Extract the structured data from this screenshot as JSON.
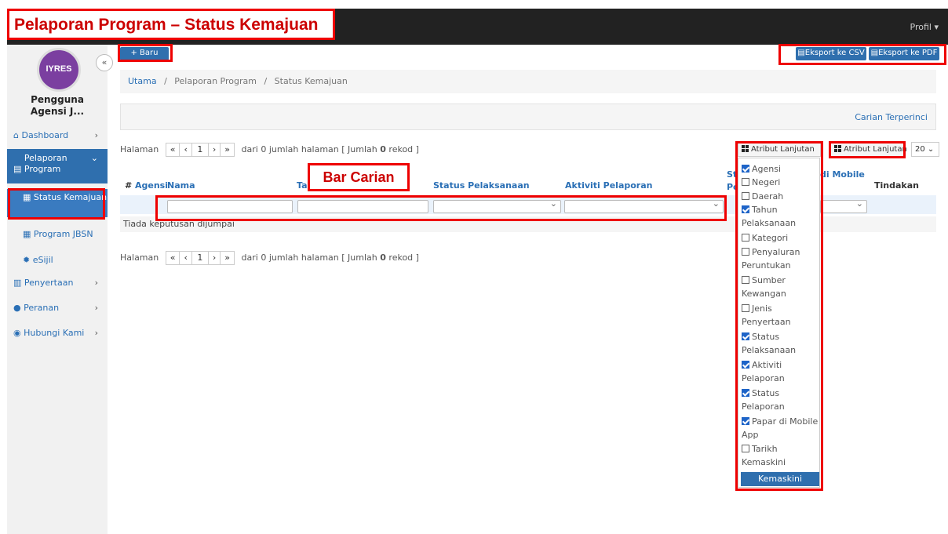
{
  "title_overlay": "Pelaporan Program – Status Kemajuan",
  "topbar": {
    "profile": "Profil ▾"
  },
  "sidebar": {
    "logo_text": "IYRES",
    "collapse": "«",
    "user_name": "Pengguna Agensi J...",
    "items": [
      {
        "label": "Dashboard",
        "icon": "home-icon",
        "chev": "›"
      },
      {
        "label": "Pelaporan Program",
        "icon": "document-icon",
        "chev": "⌄"
      },
      {
        "label": "Status Kemajuan",
        "icon": "table-icon"
      },
      {
        "label": "Program JBSN",
        "icon": "table-icon"
      },
      {
        "label": "eSijil",
        "icon": "certificate-icon"
      },
      {
        "label": "Penyertaan",
        "icon": "clipboard-icon",
        "chev": "›"
      },
      {
        "label": "Peranan",
        "icon": "user-icon",
        "chev": "›"
      },
      {
        "label": "Hubungi Kami",
        "icon": "chat-icon",
        "chev": "›"
      }
    ]
  },
  "toolbar": {
    "new_label": "+ Baru",
    "export_csv": "Eksport ke CSV",
    "export_pdf": "Eksport ke PDF"
  },
  "breadcrumb": {
    "home": "Utama",
    "sep": "/",
    "section": "Pelaporan Program",
    "page": "Status Kemajuan"
  },
  "search": {
    "advanced": "Carian Terperinci",
    "bar_label": "Bar Carian"
  },
  "pager": {
    "first": "«",
    "prev": "‹",
    "page": "1",
    "next": "›",
    "last": "»",
    "text_pre": "dari 0 jumlah halaman [ Jumlah ",
    "count": "0",
    "text_post": " rekod ]",
    "label": "Halaman"
  },
  "table": {
    "headers": {
      "num": "#",
      "agensi": "Agensi",
      "nama": "Nama",
      "tahun": "Ta",
      "status_pelaksanaan": "Status Pelaksanaan",
      "aktiviti": "Aktiviti Pelaporan",
      "status_pe": "St",
      "status_pe2": "Pe",
      "mobile": "di Mobile",
      "tindakan": "Tindakan"
    },
    "empty": "Tiada keputusan dijumpai"
  },
  "attributes": {
    "button_label": "Atribut Lanjutan",
    "per_page": "20",
    "update": "Kemaskini",
    "items": [
      {
        "label": "Agensi",
        "checked": true
      },
      {
        "label": "Negeri",
        "checked": false
      },
      {
        "label": "Daerah",
        "checked": false
      },
      {
        "label": "Tahun Pelaksanaan",
        "checked": true
      },
      {
        "label": "Kategori",
        "checked": false
      },
      {
        "label": "Penyaluran Peruntukan",
        "checked": false
      },
      {
        "label": "Sumber Kewangan",
        "checked": false
      },
      {
        "label": "Jenis Penyertaan",
        "checked": false
      },
      {
        "label": "Status Pelaksanaan",
        "checked": true
      },
      {
        "label": "Aktiviti Pelaporan",
        "checked": true
      },
      {
        "label": "Status Pelaporan",
        "checked": true
      },
      {
        "label": "Papar di Mobile App",
        "checked": true
      },
      {
        "label": "Tarikh Kemaskini",
        "checked": false
      }
    ]
  },
  "colors": {
    "accent": "#2f6fae",
    "highlight": "#e00000",
    "topbar": "#222222"
  }
}
